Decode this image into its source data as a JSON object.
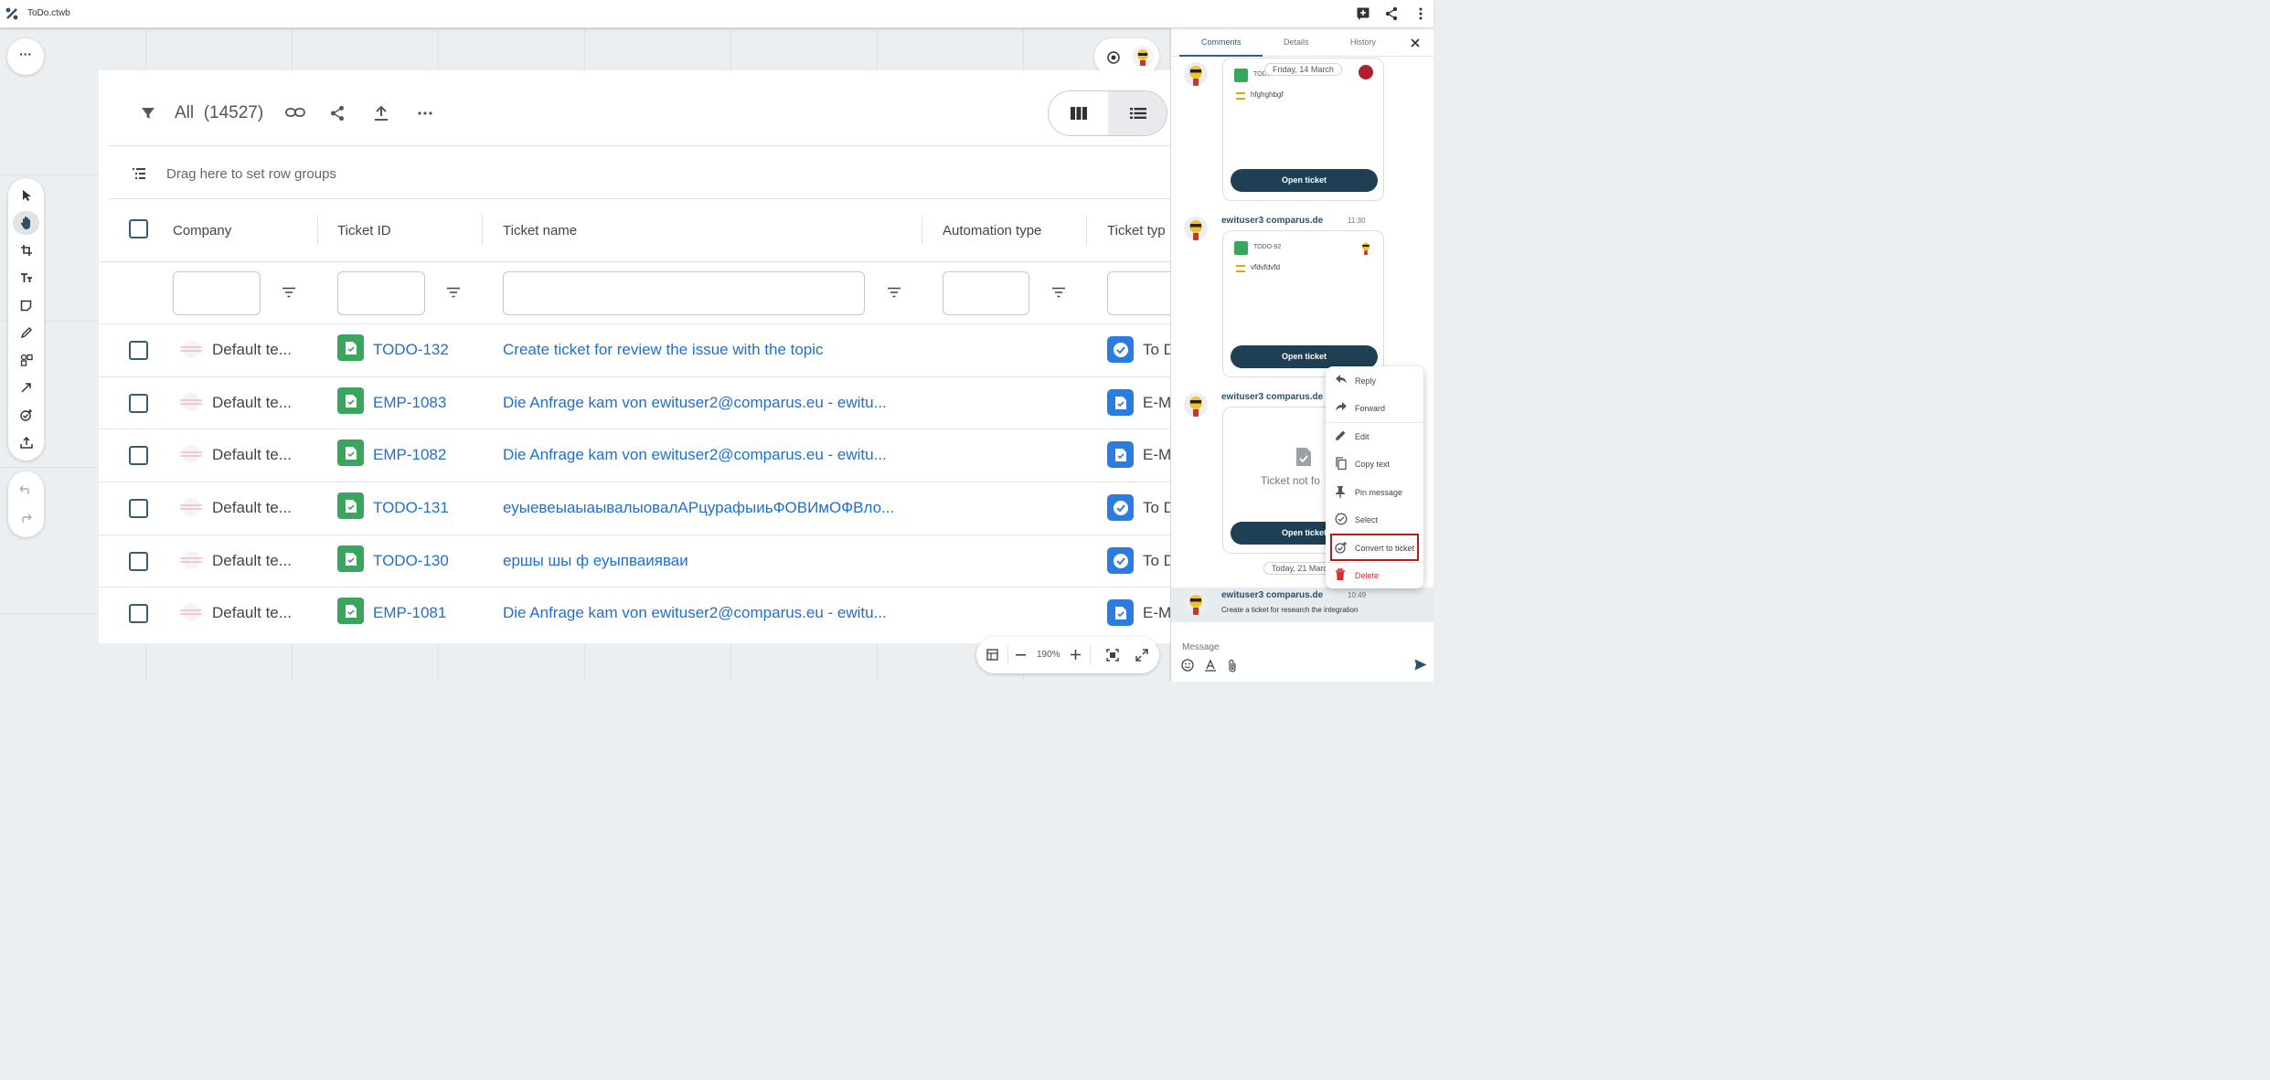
{
  "app": {
    "title": "ToDo.ctwb",
    "accent": "#1e3f54",
    "link_color": "#1f6fd1"
  },
  "toolbar": {
    "all_label": "All",
    "count": "(14527)"
  },
  "row_groups": {
    "placeholder": "Drag here to set row groups"
  },
  "columns": [
    "Company",
    "Ticket ID",
    "Ticket name",
    "Automation type",
    "Ticket typ"
  ],
  "rows": [
    {
      "company": "Default te...",
      "id": "TODO-132",
      "name": "Create ticket for review the issue with the topic",
      "type": "To D"
    },
    {
      "company": "Default te...",
      "id": "EMP-1083",
      "name": "Die Anfrage kam von ewituser2@comparus.eu - ewitu...",
      "type": "E-M"
    },
    {
      "company": "Default te...",
      "id": "EMP-1082",
      "name": "Die Anfrage kam von ewituser2@comparus.eu - ewitu...",
      "type": "E-M"
    },
    {
      "company": "Default te...",
      "id": "TODO-131",
      "name": "еуыевеыаыаывалыовалАРцурафыиьФОВИмОФВло...",
      "type": "To D"
    },
    {
      "company": "Default te...",
      "id": "TODO-130",
      "name": "ершы шы ф еуыпваияваи",
      "type": "To D"
    },
    {
      "company": "Default te...",
      "id": "EMP-1081",
      "name": "Die Anfrage kam von ewituser2@comparus.eu - ewitu...",
      "type": "E-M"
    }
  ],
  "zoom": {
    "level": "190%"
  },
  "panel": {
    "tabs": [
      "Comments",
      "Details",
      "History"
    ],
    "messages": [
      {
        "code": "TODO",
        "date_pill": "Friday, 14 March",
        "text": "hfghghbgf",
        "button": "Open ticket"
      },
      {
        "user": "ewituser3 comparus.de",
        "time": "11:30",
        "code": "TODO-92",
        "text": "vfdvfdvfd",
        "button": "Open ticket"
      },
      {
        "user": "ewituser3 comparus.de",
        "time": "1",
        "not_found": "Ticket not fo",
        "button": "Open ticket"
      }
    ],
    "date_pill_2": "Today, 21 March",
    "last_message": {
      "user": "ewituser3 comparus.de",
      "time": "10:49",
      "text": "Create a ticket for research the integration"
    },
    "input_placeholder": "Message"
  },
  "context_menu": [
    {
      "label": "Reply",
      "icon": "reply-icon"
    },
    {
      "label": "Forward",
      "icon": "forward-icon"
    },
    {
      "label": "Edit",
      "icon": "pencil-icon"
    },
    {
      "label": "Copy text",
      "icon": "copy-icon"
    },
    {
      "label": "Pin message",
      "icon": "pin-icon"
    },
    {
      "label": "Select",
      "icon": "check-circle-icon"
    },
    {
      "label": "Convert to ticket",
      "icon": "convert-ticket-icon"
    },
    {
      "label": "Delete",
      "icon": "trash-icon"
    }
  ]
}
